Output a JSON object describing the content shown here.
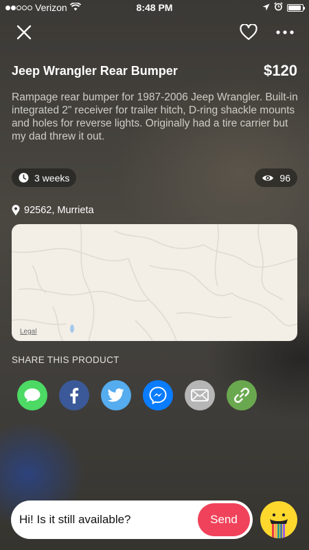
{
  "status_bar": {
    "carrier": "Verizon",
    "time": "8:48 PM",
    "signal_bars": 2,
    "battery_level": 0.9
  },
  "listing": {
    "title": "Jeep Wrangler Rear Bumper",
    "price": "$120",
    "description": "Rampage rear bumper for 1987-2006 Jeep Wrangler. Built-in integrated 2\" receiver for trailer hitch, D-ring shackle mounts and holes for reverse lights. Originally had a tire carrier but my dad threw it out.",
    "posted_ago": "3 weeks",
    "views": "96",
    "location": "92562, Murrieta"
  },
  "map": {
    "legal_label": "Legal"
  },
  "share": {
    "title": "SHARE THIS PRODUCT",
    "buttons": [
      {
        "name": "messages",
        "color": "#4cd964",
        "icon": "speech-bubble-icon"
      },
      {
        "name": "facebook",
        "color": "#3b5998",
        "icon": "facebook-icon"
      },
      {
        "name": "twitter",
        "color": "#55acee",
        "icon": "twitter-bird-icon"
      },
      {
        "name": "messenger",
        "color": "#0a7cff",
        "icon": "messenger-icon"
      },
      {
        "name": "email",
        "color": "#b6b6b6",
        "icon": "envelope-icon"
      },
      {
        "name": "copy-link",
        "color": "#6aa84f",
        "icon": "link-icon"
      }
    ]
  },
  "message": {
    "value": "Hi! Is it still available?",
    "send_label": "Send"
  },
  "colors": {
    "send": "#f0435b",
    "mascot": "#ffd82e"
  }
}
